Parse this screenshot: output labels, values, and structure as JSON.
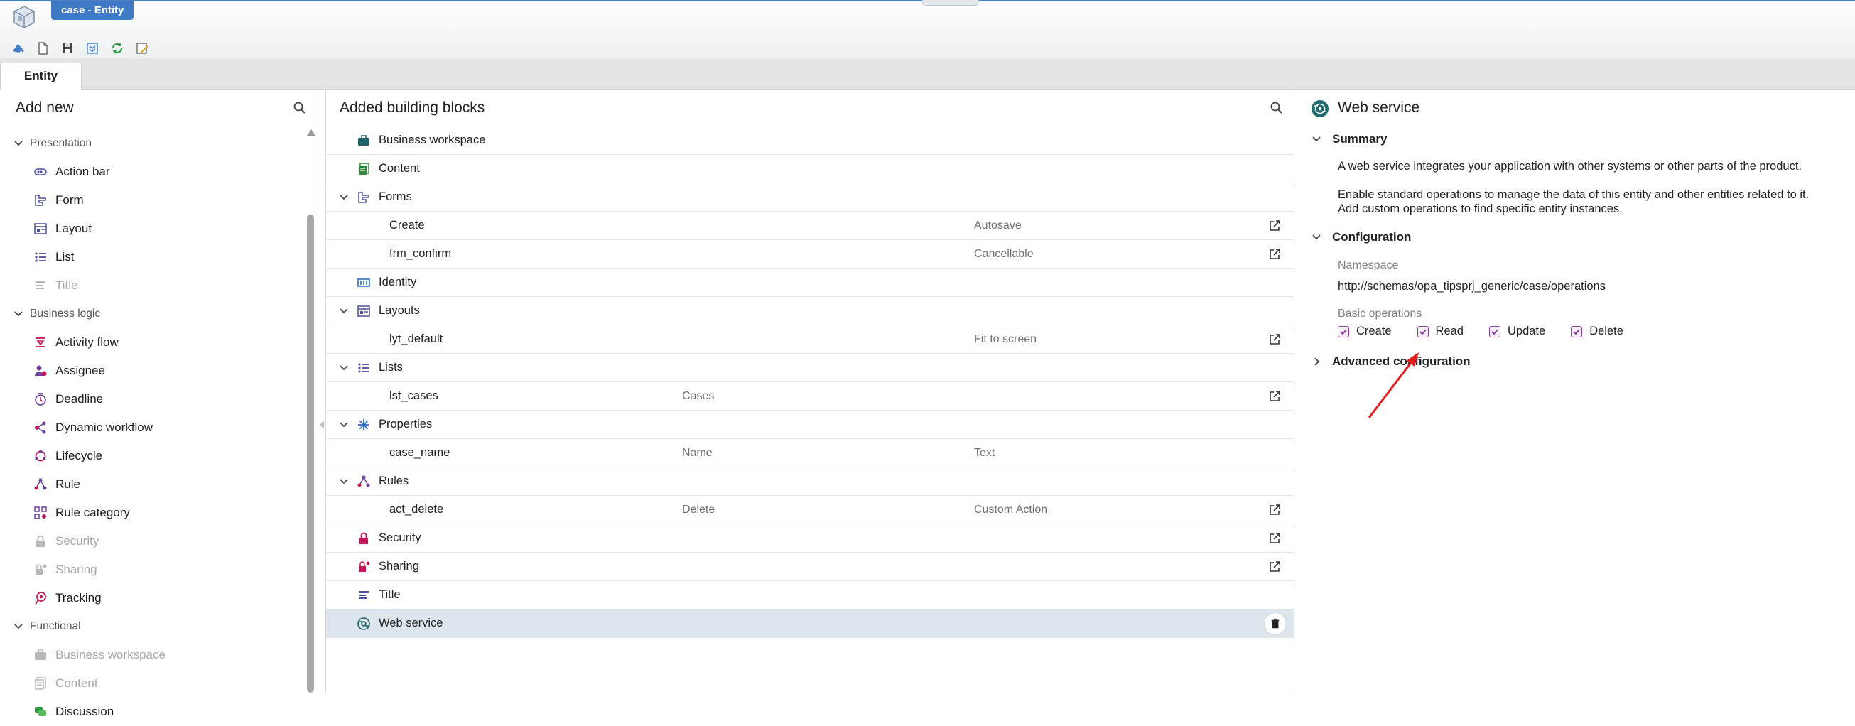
{
  "window": {
    "title": "case - Entity"
  },
  "tabs": [
    {
      "label": "Entity"
    }
  ],
  "left_panel": {
    "title": "Add new",
    "groups": [
      {
        "label": "Presentation",
        "items": [
          {
            "label": "Action bar",
            "icon": "action-bar-icon",
            "disabled": false
          },
          {
            "label": "Form",
            "icon": "form-icon",
            "disabled": false
          },
          {
            "label": "Layout",
            "icon": "layout-icon",
            "disabled": false
          },
          {
            "label": "List",
            "icon": "list-icon",
            "disabled": false
          },
          {
            "label": "Title",
            "icon": "title-icon",
            "disabled": true
          }
        ]
      },
      {
        "label": "Business logic",
        "items": [
          {
            "label": "Activity flow",
            "icon": "activity-flow-icon",
            "disabled": false
          },
          {
            "label": "Assignee",
            "icon": "assignee-icon",
            "disabled": false
          },
          {
            "label": "Deadline",
            "icon": "deadline-icon",
            "disabled": false
          },
          {
            "label": "Dynamic workflow",
            "icon": "dynamic-workflow-icon",
            "disabled": false
          },
          {
            "label": "Lifecycle",
            "icon": "lifecycle-icon",
            "disabled": false
          },
          {
            "label": "Rule",
            "icon": "rule-icon",
            "disabled": false
          },
          {
            "label": "Rule category",
            "icon": "rule-category-icon",
            "disabled": false
          },
          {
            "label": "Security",
            "icon": "lock-icon",
            "disabled": true
          },
          {
            "label": "Sharing",
            "icon": "sharing-icon",
            "disabled": true
          },
          {
            "label": "Tracking",
            "icon": "tracking-icon",
            "disabled": false
          }
        ]
      },
      {
        "label": "Functional",
        "items": [
          {
            "label": "Business workspace",
            "icon": "briefcase-icon",
            "disabled": true
          },
          {
            "label": "Content",
            "icon": "content-icon",
            "disabled": true
          },
          {
            "label": "Discussion",
            "icon": "discussion-icon",
            "disabled": false
          }
        ]
      }
    ]
  },
  "middle_panel": {
    "title": "Added building blocks",
    "rows": [
      {
        "name": "Business workspace",
        "c2": "",
        "c3": "",
        "level": 0
      },
      {
        "name": "Content",
        "c2": "",
        "c3": "",
        "level": 0
      },
      {
        "name": "Forms",
        "c2": "",
        "c3": "",
        "level": 0
      },
      {
        "name": "Create",
        "c2": "",
        "c3": "Autosave",
        "level": 1
      },
      {
        "name": "frm_confirm",
        "c2": "",
        "c3": "Cancellable",
        "level": 1
      },
      {
        "name": "Identity",
        "c2": "",
        "c3": "",
        "level": 0
      },
      {
        "name": "Layouts",
        "c2": "",
        "c3": "",
        "level": 0
      },
      {
        "name": "lyt_default",
        "c2": "",
        "c3": "Fit to screen",
        "level": 1
      },
      {
        "name": "Lists",
        "c2": "",
        "c3": "",
        "level": 0
      },
      {
        "name": "lst_cases",
        "c2": "Cases",
        "c3": "",
        "level": 1
      },
      {
        "name": "Properties",
        "c2": "",
        "c3": "",
        "level": 0
      },
      {
        "name": "case_name",
        "c2": "Name",
        "c3": "Text",
        "level": 1
      },
      {
        "name": "Rules",
        "c2": "",
        "c3": "",
        "level": 0
      },
      {
        "name": "act_delete",
        "c2": "Delete",
        "c3": "Custom Action",
        "level": 1
      },
      {
        "name": "Security",
        "c2": "",
        "c3": "",
        "level": 0
      },
      {
        "name": "Sharing",
        "c2": "",
        "c3": "",
        "level": 0
      },
      {
        "name": "Title",
        "c2": "",
        "c3": "",
        "level": 0
      },
      {
        "name": "Web service",
        "c2": "",
        "c3": "",
        "level": 0,
        "selected": true
      }
    ]
  },
  "right_panel": {
    "title": "Web service",
    "summary": {
      "heading": "Summary",
      "p1": "A web service integrates your application with other systems or other parts of the product.",
      "p2a": "Enable standard operations to manage the data of this entity and other entities related to it.",
      "p2b": "Add custom operations to find specific entity instances."
    },
    "configuration": {
      "heading": "Configuration",
      "namespace_label": "Namespace",
      "namespace_value": "http://schemas/opa_tipsprj_generic/case/operations",
      "basic_ops_label": "Basic operations",
      "ops": [
        {
          "label": "Create",
          "checked": true
        },
        {
          "label": "Read",
          "checked": true
        },
        {
          "label": "Update",
          "checked": true
        },
        {
          "label": "Delete",
          "checked": true
        }
      ]
    },
    "advanced": {
      "heading": "Advanced configuration"
    }
  },
  "colors": {
    "accent": "#3f7ac6",
    "checkbox": "#8c3fa0",
    "selected_row": "#dde6ec",
    "annotation_arrow": "#e02020"
  }
}
